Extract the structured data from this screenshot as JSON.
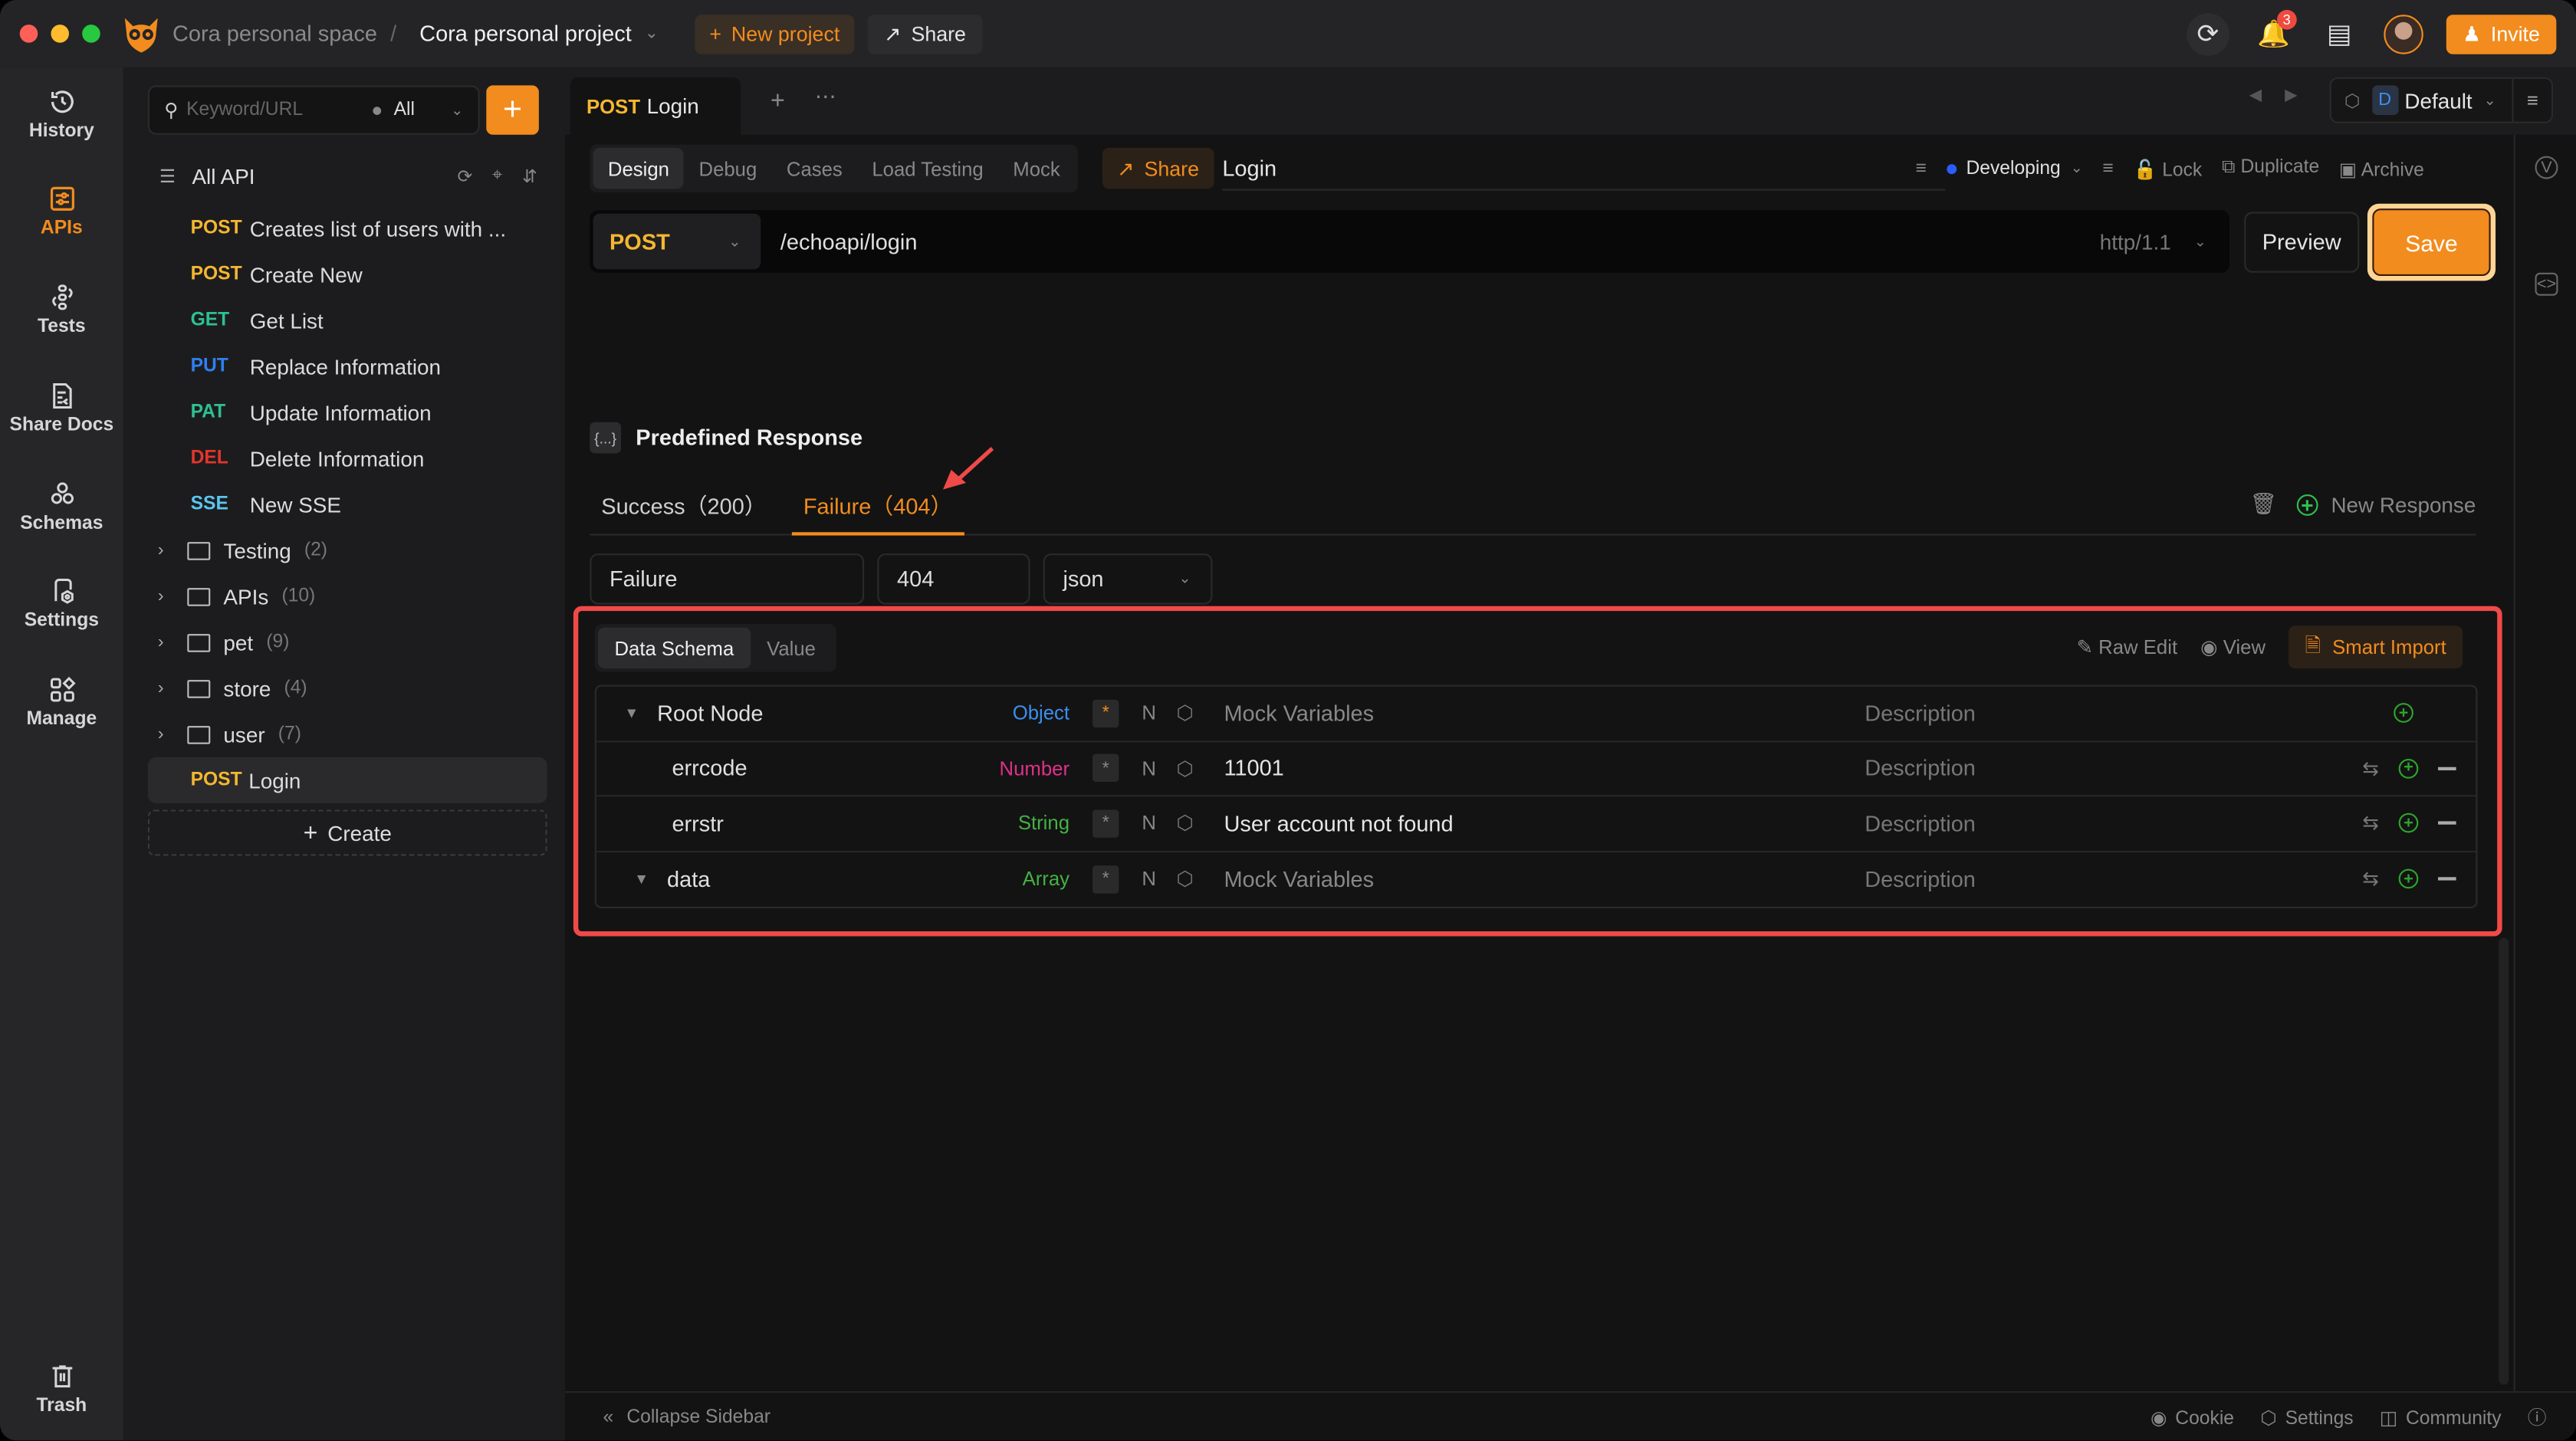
{
  "window": {
    "traffic_lights": [
      "close",
      "minimize",
      "zoom"
    ],
    "breadcrumb": {
      "space": "Cora personal space",
      "separator": "/",
      "project": "Cora personal project"
    },
    "new_project_label": "New project",
    "share_label": "Share",
    "notification_count": "3",
    "invite_label": "Invite"
  },
  "rail": {
    "items": [
      {
        "label": "History",
        "icon": "history-icon",
        "active": false
      },
      {
        "label": "APIs",
        "icon": "apis-icon",
        "active": true
      },
      {
        "label": "Tests",
        "icon": "tests-icon",
        "active": false
      },
      {
        "label": "Share Docs",
        "icon": "share-docs-icon",
        "active": false
      },
      {
        "label": "Schemas",
        "icon": "schemas-icon",
        "active": false
      },
      {
        "label": "Settings",
        "icon": "settings-icon",
        "active": false
      },
      {
        "label": "Manage",
        "icon": "manage-icon",
        "active": false
      }
    ],
    "trash_label": "Trash"
  },
  "tree": {
    "search_placeholder": "Keyword/URL",
    "filter_value": "All",
    "add_label": "+",
    "root_label": "All API",
    "apis": [
      {
        "method": "POST",
        "name": "Creates list of users with ..."
      },
      {
        "method": "POST",
        "name": "Create New"
      },
      {
        "method": "GET",
        "name": "Get List"
      },
      {
        "method": "PUT",
        "name": "Replace Information"
      },
      {
        "method": "PAT",
        "name": "Update Information"
      },
      {
        "method": "DEL",
        "name": "Delete Information"
      },
      {
        "method": "SSE",
        "name": "New SSE"
      }
    ],
    "folders": [
      {
        "name": "Testing",
        "count": "(2)"
      },
      {
        "name": "APIs",
        "count": "(10)"
      },
      {
        "name": "pet",
        "count": "(9)"
      },
      {
        "name": "store",
        "count": "(4)"
      },
      {
        "name": "user",
        "count": "(7)"
      }
    ],
    "selected": {
      "method": "POST",
      "name": "Login"
    },
    "create_label": "Create"
  },
  "tabs": {
    "active": {
      "method": "POST",
      "name": "Login"
    },
    "environment": {
      "initial": "D",
      "name": "Default"
    }
  },
  "editor": {
    "subtabs": [
      "Design",
      "Debug",
      "Cases",
      "Load Testing",
      "Mock"
    ],
    "active_subtab": "Design",
    "share_label": "Share",
    "api_name": "Login",
    "status": "Developing",
    "status_color": "#2b5cff",
    "actions": {
      "lock": "Lock",
      "duplicate": "Duplicate",
      "archive": "Archive"
    },
    "method": "POST",
    "url": "/echoapi/login",
    "protocol": "http/1.1",
    "preview_label": "Preview",
    "save_label": "Save"
  },
  "response": {
    "section_title": "Predefined Response",
    "tabs": [
      {
        "label": "Success（200）",
        "active": false
      },
      {
        "label": "Failure（404）",
        "active": true
      }
    ],
    "new_response_label": "New Response",
    "name_value": "Failure",
    "status_code_value": "404",
    "content_type": "json",
    "schema_tabs": [
      "Data Schema",
      "Value"
    ],
    "active_schema_tab": "Data Schema",
    "tools": {
      "raw_edit": "Raw Edit",
      "view": "View",
      "smart_import": "Smart Import"
    },
    "rows": [
      {
        "name": "Root Node",
        "type": "Object",
        "required": true,
        "nullable": "N",
        "mock": "Mock Variables",
        "mock_is_placeholder": true,
        "description": "Description",
        "expandable": true,
        "depth": 0
      },
      {
        "name": "errcode",
        "type": "Number",
        "required": false,
        "nullable": "N",
        "mock": "11001",
        "mock_is_placeholder": false,
        "description": "Description",
        "expandable": false,
        "depth": 1
      },
      {
        "name": "errstr",
        "type": "String",
        "required": false,
        "nullable": "N",
        "mock": "User account not found",
        "mock_is_placeholder": false,
        "description": "Description",
        "expandable": false,
        "depth": 1
      },
      {
        "name": "data",
        "type": "Array",
        "required": false,
        "nullable": "N",
        "mock": "Mock Variables",
        "mock_is_placeholder": true,
        "description": "Description",
        "expandable": true,
        "depth": 1
      }
    ]
  },
  "footer": {
    "collapse_label": "Collapse Sidebar",
    "links": [
      "Cookie",
      "Settings",
      "Community"
    ]
  },
  "colors": {
    "accent": "#f28c1e",
    "highlight_box": "#ef4a48",
    "post": "#f5b731",
    "get": "#2ec18f",
    "put": "#2f7ff0",
    "del": "#e5352b",
    "sse": "#5bc6f0"
  }
}
